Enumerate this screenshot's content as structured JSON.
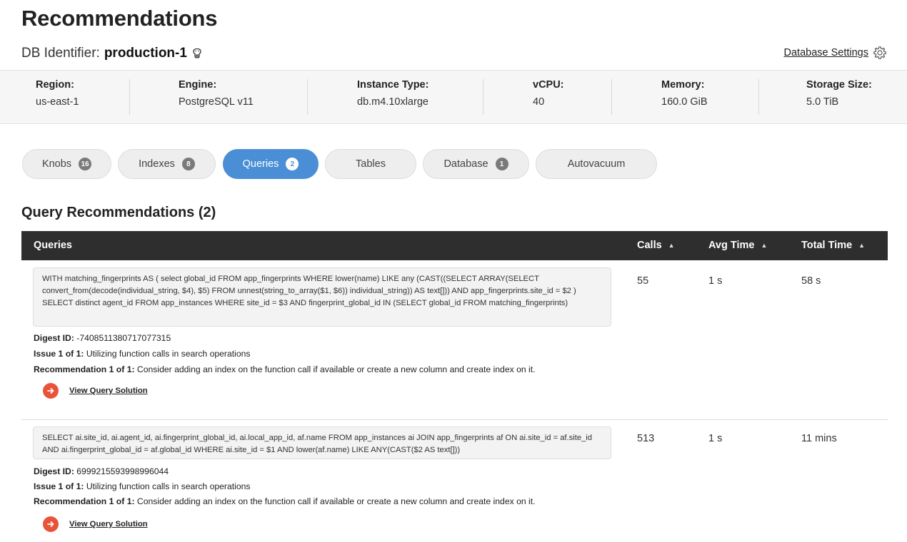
{
  "page": {
    "title": "Recommendations"
  },
  "db": {
    "identifier_label": "DB Identifier:",
    "identifier": "production-1",
    "settings_label": "Database Settings"
  },
  "info": [
    {
      "label": "Region:",
      "value": "us-east-1"
    },
    {
      "label": "Engine:",
      "value": "PostgreSQL v11"
    },
    {
      "label": "Instance Type:",
      "value": "db.m4.10xlarge"
    },
    {
      "label": "vCPU:",
      "value": "40"
    },
    {
      "label": "Memory:",
      "value": "160.0 GiB"
    },
    {
      "label": "Storage Size:",
      "value": "5.0 TiB"
    }
  ],
  "tabs": [
    {
      "label": "Knobs",
      "badge": "16",
      "active": false
    },
    {
      "label": "Indexes",
      "badge": "8",
      "active": false
    },
    {
      "label": "Queries",
      "badge": "2",
      "active": true
    },
    {
      "label": "Tables",
      "badge": "",
      "active": false
    },
    {
      "label": "Database",
      "badge": "1",
      "active": false
    },
    {
      "label": "Autovacuum",
      "badge": "",
      "active": false
    }
  ],
  "section": {
    "title": "Query Recommendations (2)"
  },
  "table": {
    "headers": {
      "queries": "Queries",
      "calls": "Calls",
      "avg_time": "Avg Time",
      "total_time": "Total Time"
    },
    "sort_icon": "sort-ascending-icon",
    "rows": [
      {
        "query": "WITH matching_fingerprints AS ( select global_id FROM app_fingerprints WHERE lower(name) LIKE any (CAST((SELECT ARRAY(SELECT convert_from(decode(individual_string, $4), $5) FROM unnest(string_to_array($1, $6)) individual_string)) AS text[])) AND app_fingerprints.site_id = $2 ) SELECT distinct agent_id FROM app_instances WHERE site_id = $3 AND fingerprint_global_id IN (SELECT global_id FROM matching_fingerprints)",
        "calls": "55",
        "avg_time": "1 s",
        "total_time": "58 s",
        "digest_label": "Digest ID:",
        "digest_id": "-7408511380717077315",
        "issue_label": "Issue 1 of 1:",
        "issue": "Utilizing function calls in search operations",
        "recommendation_label": "Recommendation 1 of 1:",
        "recommendation": "Consider adding an index on the function call if available or create a new column and create index on it.",
        "solution_label": "View Query Solution"
      },
      {
        "query": "SELECT ai.site_id, ai.agent_id, ai.fingerprint_global_id, ai.local_app_id, af.name FROM app_instances ai JOIN app_fingerprints af ON ai.site_id = af.site_id AND ai.fingerprint_global_id = af.global_id WHERE ai.site_id = $1 AND lower(af.name) LIKE ANY(CAST($2 AS text[]))",
        "calls": "513",
        "avg_time": "1 s",
        "total_time": "11 mins",
        "digest_label": "Digest ID:",
        "digest_id": "6999215593998996044",
        "issue_label": "Issue 1 of 1:",
        "issue": "Utilizing function calls in search operations",
        "recommendation_label": "Recommendation 1 of 1:",
        "recommendation": "Consider adding an index on the function call if available or create a new column and create index on it.",
        "solution_label": "View Query Solution"
      }
    ]
  },
  "colors": {
    "active_tab": "#4a8fd6",
    "header_bg": "#2e2e2e",
    "solution_icon": "#e8533a",
    "info_bg": "#f6f6f6"
  },
  "icons": {
    "db": "postgresql-elephant-icon",
    "settings": "gear-icon",
    "solution": "arrow-right-circle-icon"
  }
}
